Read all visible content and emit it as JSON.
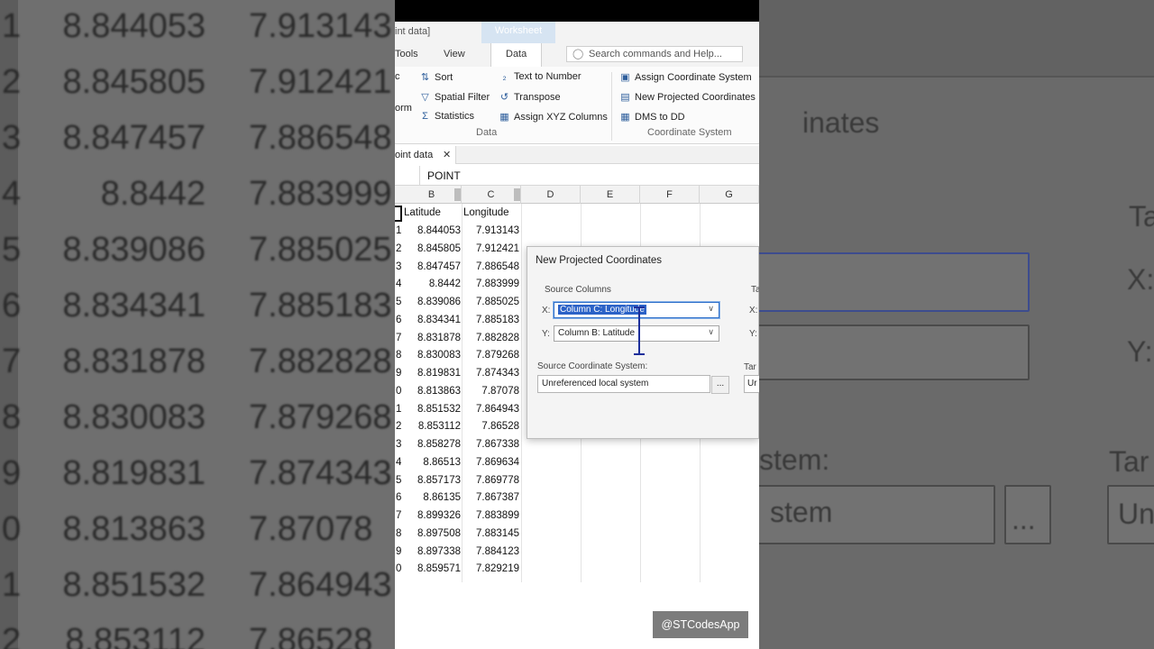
{
  "window": {
    "title_fragment": "int data]",
    "worksheet_tab": "Worksheet"
  },
  "menu": {
    "tabs": [
      "Tools",
      "View",
      "Data"
    ],
    "active_tab": "Data",
    "search_placeholder": "Search commands and Help..."
  },
  "ribbon": {
    "left_cut": [
      "c",
      "orm"
    ],
    "items": {
      "sort": "Sort",
      "spatial_filter": "Spatial Filter",
      "statistics": "Statistics",
      "text_to_number": "Text to Number",
      "transpose": "Transpose",
      "assign_xyz": "Assign XYZ Columns",
      "assign_coord": "Assign Coordinate System",
      "new_projected": "New Projected Coordinates",
      "dms_to_dd": "DMS to DD"
    },
    "groups": {
      "data": "Data",
      "coordinate_system": "Coordinate System"
    }
  },
  "document": {
    "tab_label": "oint data",
    "formula_value": "POINT"
  },
  "columns": [
    "B",
    "C",
    "D",
    "E",
    "F",
    "G"
  ],
  "table": {
    "headers": {
      "b": "Latitude",
      "c": "Longitude"
    },
    "rows": [
      {
        "i": "1",
        "b": "8.844053",
        "c": "7.913143"
      },
      {
        "i": "2",
        "b": "8.845805",
        "c": "7.912421"
      },
      {
        "i": "3",
        "b": "8.847457",
        "c": "7.886548"
      },
      {
        "i": "4",
        "b": "8.8442",
        "c": "7.883999"
      },
      {
        "i": "5",
        "b": "8.839086",
        "c": "7.885025"
      },
      {
        "i": "6",
        "b": "8.834341",
        "c": "7.885183"
      },
      {
        "i": "7",
        "b": "8.831878",
        "c": "7.882828"
      },
      {
        "i": "8",
        "b": "8.830083",
        "c": "7.879268"
      },
      {
        "i": "9",
        "b": "8.819831",
        "c": "7.874343"
      },
      {
        "i": "0",
        "b": "8.813863",
        "c": "7.87078"
      },
      {
        "i": "1",
        "b": "8.851532",
        "c": "7.864943"
      },
      {
        "i": "2",
        "b": "8.853112",
        "c": "7.86528"
      },
      {
        "i": "3",
        "b": "8.858278",
        "c": "7.867338"
      },
      {
        "i": "4",
        "b": "8.86513",
        "c": "7.869634"
      },
      {
        "i": "5",
        "b": "8.857173",
        "c": "7.869778"
      },
      {
        "i": "6",
        "b": "8.86135",
        "c": "7.867387"
      },
      {
        "i": "7",
        "b": "8.899326",
        "c": "7.883899"
      },
      {
        "i": "8",
        "b": "8.897508",
        "c": "7.883145"
      },
      {
        "i": "9",
        "b": "8.897338",
        "c": "7.884123"
      },
      {
        "i": "0",
        "b": "8.859571",
        "c": "7.829219"
      }
    ]
  },
  "dialog": {
    "title": "New Projected Coordinates",
    "source_columns_label": "Source Columns",
    "x_label": "X:",
    "x_value": "Column C:  Longitude",
    "y_label": "Y:",
    "y_value": "Column B:  Latitude",
    "source_cs_label": "Source Coordinate System:",
    "source_cs_value": "Unreferenced local system",
    "browse_label": "...",
    "target_cut": "Ta",
    "target_x_cut": "X:",
    "target_y_cut": "Y:",
    "target_cs_cut": "Tar",
    "target_val_cut": "Ur"
  },
  "background": {
    "left_rows": [
      {
        "i": "1",
        "b": "8.844053",
        "c": "7.913143"
      },
      {
        "i": "2",
        "b": "8.845805",
        "c": "7.912421"
      },
      {
        "i": "3",
        "b": "8.847457",
        "c": "7.886548"
      },
      {
        "i": "4",
        "b": "8.8442",
        "c": "7.883999"
      },
      {
        "i": "5",
        "b": "8.839086",
        "c": "7.885025"
      },
      {
        "i": "6",
        "b": "8.834341",
        "c": "7.885183"
      },
      {
        "i": "7",
        "b": "8.831878",
        "c": "7.882828"
      },
      {
        "i": "8",
        "b": "8.830083",
        "c": "7.879268"
      },
      {
        "i": "9",
        "b": "8.819831",
        "c": "7.874343"
      },
      {
        "i": "0",
        "b": "8.813863",
        "c": "7.87078"
      },
      {
        "i": "1",
        "b": "8.851532",
        "c": "7.864943"
      },
      {
        "i": "2",
        "b": "8.853112",
        "c": "7.86528"
      }
    ],
    "right_texts": {
      "inates": "inates",
      "stem_colon": "stem:",
      "stem": "stem",
      "dots": "...",
      "ta": "Ta",
      "x": "X:",
      "y": "Y:",
      "tar": "Tar",
      "un": "Un"
    }
  },
  "watermark": "@STCodesApp"
}
